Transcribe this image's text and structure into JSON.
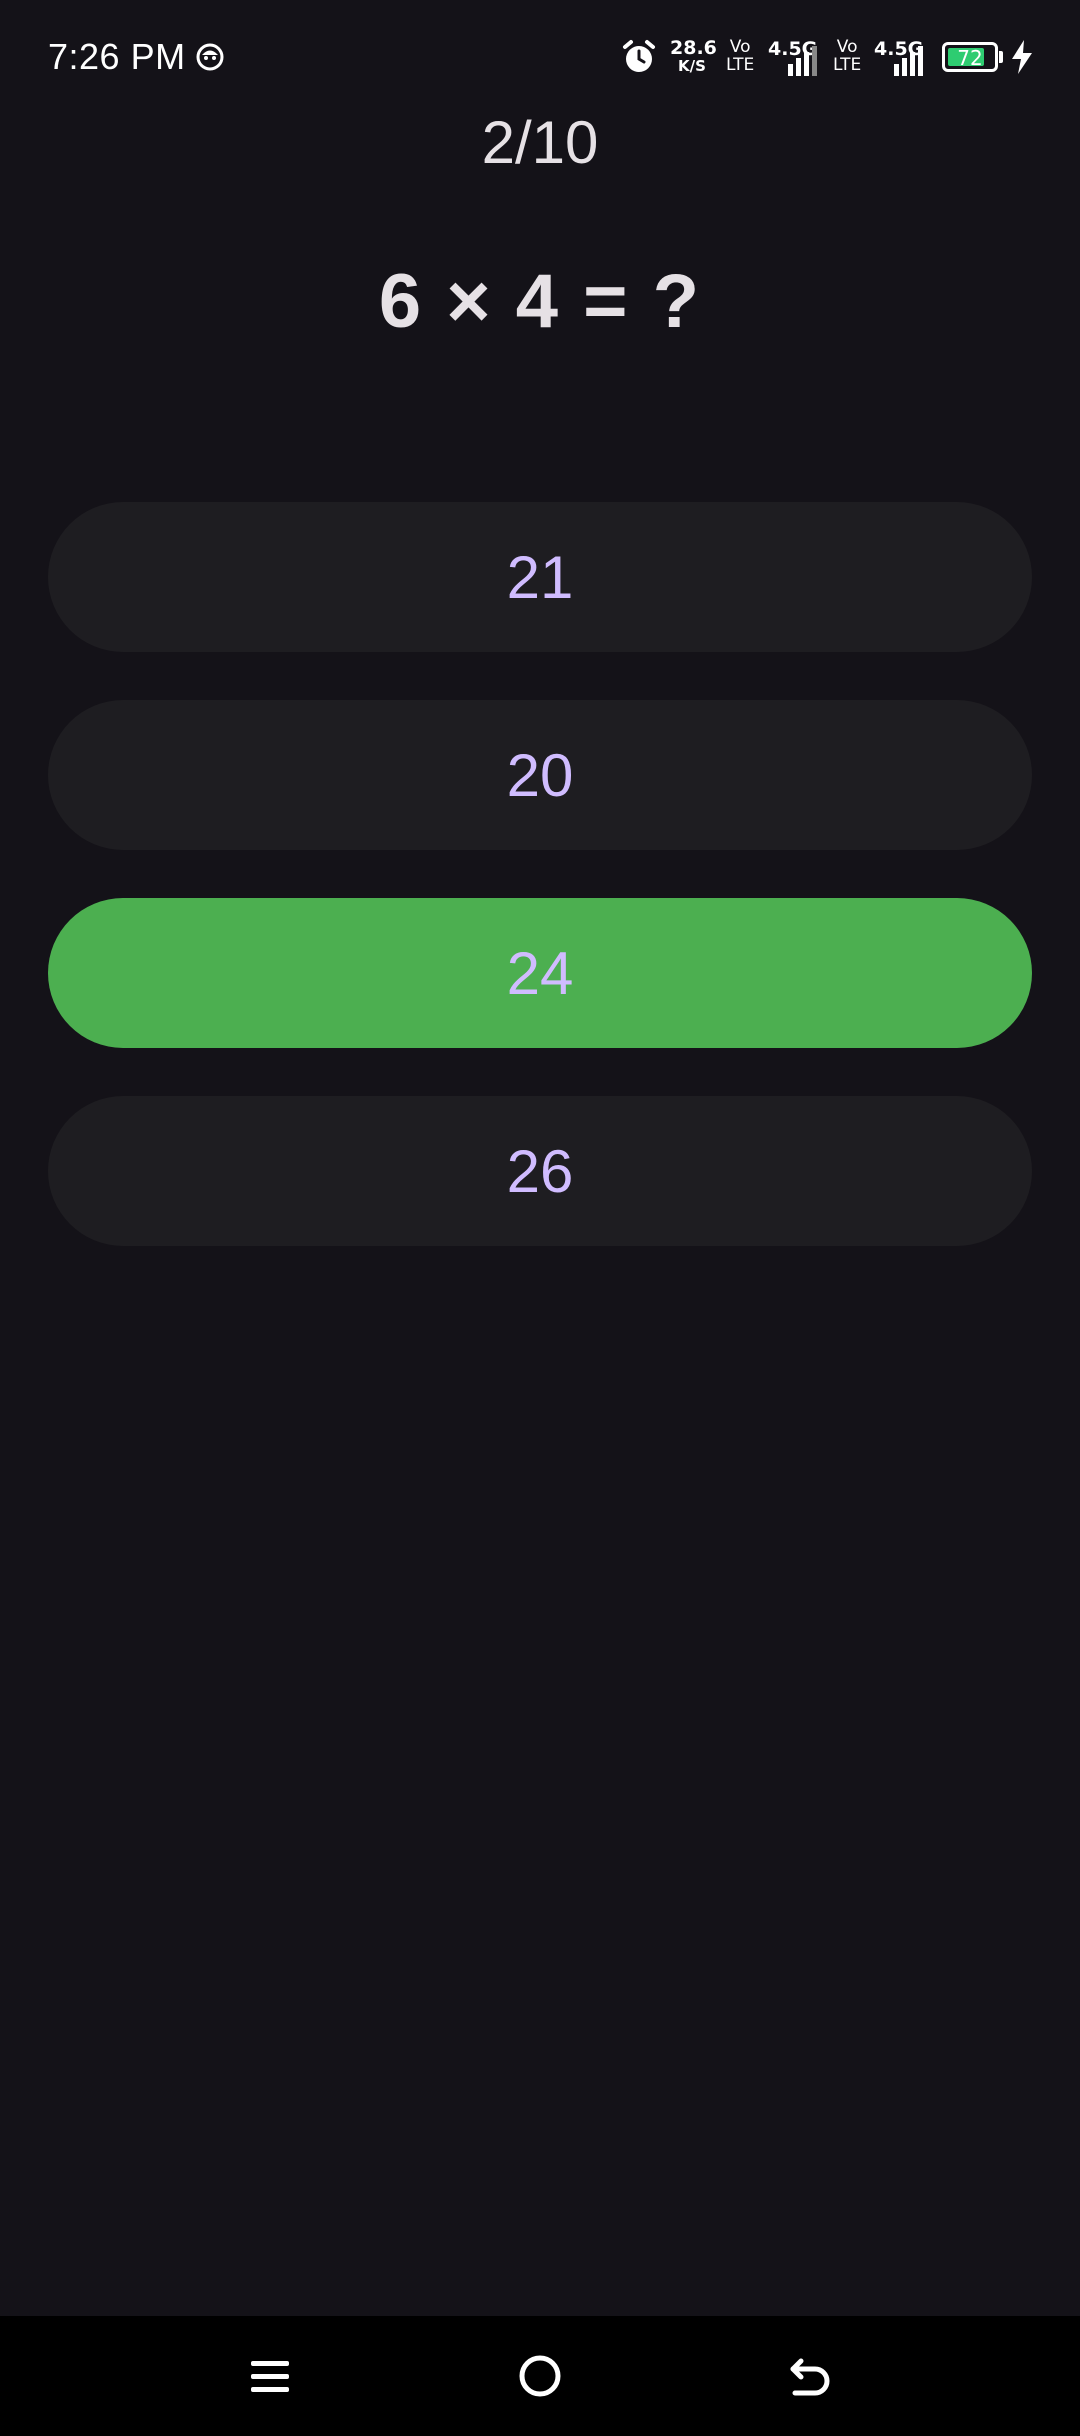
{
  "status_bar": {
    "time": "7:26 PM",
    "speed_value": "28.6",
    "speed_unit": "K/S",
    "volte_top": "Vo",
    "volte_bottom": "LTE",
    "network_type": "4.5G",
    "battery_level": "72",
    "icons": [
      "emoji-icon",
      "alarm-icon",
      "signal-icon",
      "battery-icon",
      "charging-icon"
    ]
  },
  "quiz": {
    "progress": "2/10",
    "question": "6 × 4 = ?",
    "answers": [
      {
        "label": "21",
        "state": "default"
      },
      {
        "label": "20",
        "state": "default"
      },
      {
        "label": "24",
        "state": "correct"
      },
      {
        "label": "26",
        "state": "default"
      }
    ]
  },
  "colors": {
    "background": "#141218",
    "button": "#1E1D21",
    "correct": "#4CAF50",
    "answer_text": "#D0BCFF",
    "text": "#E6E1E5"
  },
  "nav_bar": {
    "icons": [
      "menu-icon",
      "home-icon",
      "back-icon"
    ]
  }
}
